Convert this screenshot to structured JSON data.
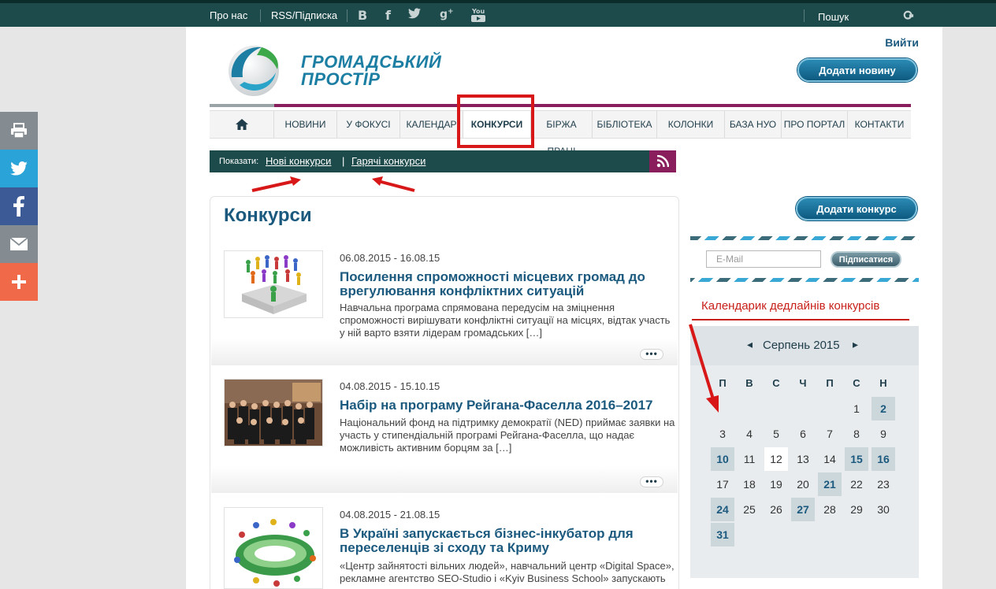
{
  "topbar": {
    "about": "Про нас",
    "rss": "RSS/Підписка",
    "social_icons": [
      "B",
      "f",
      "twitter",
      "g+",
      "youtube"
    ],
    "youtube_label": "You",
    "search_placeholder": "Пошук"
  },
  "share_bar": [
    {
      "icon": "print-icon",
      "color": "#848c91"
    },
    {
      "icon": "twitter-icon",
      "color": "#2aa3d8"
    },
    {
      "icon": "facebook-icon",
      "color": "#3b5a96"
    },
    {
      "icon": "mail-icon",
      "color": "#848c91"
    },
    {
      "icon": "plus-icon",
      "color": "#f06a4a"
    }
  ],
  "header": {
    "logo_line1": "ГРОМАДСЬКИЙ",
    "logo_line2": "ПРОСТІР",
    "login": "Вийти",
    "add_news": "Додати новину"
  },
  "nav": [
    {
      "label": ""
    },
    {
      "label": "НОВИНИ"
    },
    {
      "label": "У ФОКУСІ"
    },
    {
      "label": "КАЛЕНДАР"
    },
    {
      "label": "КОНКУРСИ",
      "active": true
    },
    {
      "label": "БІРЖА ПРАЦІ"
    },
    {
      "label": "БІБЛІОТЕКА"
    },
    {
      "label": "КОЛОНКИ"
    },
    {
      "label": "БАЗА НУО"
    },
    {
      "label": "ПРО ПОРТАЛ"
    },
    {
      "label": "КОНТАКТИ"
    }
  ],
  "filter": {
    "label": "Показати:",
    "link_new": "Нові конкурси",
    "separator": "|",
    "link_hot": "Гарячі конкурси"
  },
  "main": {
    "title": "Конкурси",
    "articles": [
      {
        "date": "06.08.2015 - 16.08.15",
        "title": "Посилення спроможності місцевих громад до врегулювання конфліктних ситуацій",
        "text": "Навчальна програма спрямована передусім на зміцнення спроможності вирішувати конфліктні ситуації на місцях, відтак участь у ній варто взяти лідерам громадських […]",
        "more": "•••"
      },
      {
        "date": "04.08.2015 - 15.10.15",
        "title": "Набір на програму Рейгана-Фаселла 2016–2017",
        "text": "Національний фонд на підтримку демократії (NED) приймає заявки на участь у стипендіальній програмі Рейгана-Фаселла, що надає можливість активним борцям за […]",
        "more": "•••"
      },
      {
        "date": "04.08.2015 - 21.08.15",
        "title": "В Україні запускається бізнес-інкубатор для переселенців зі сходу та Криму",
        "text": "«Центр зайнятості вільних людей», навчальний центр «Digital Space», рекламне агентство SEO-Studio і «Kyiv Business School» запускають"
      }
    ]
  },
  "sidebar": {
    "add_contest": "Додати конкурс",
    "email_placeholder": "E-Mail",
    "subscribe": "Підписатися",
    "annotation": "Календарик дедлайнів конкурсів",
    "calendar": {
      "month": "Серпень 2015",
      "weekdays": [
        "П",
        "В",
        "С",
        "Ч",
        "П",
        "С",
        "Н"
      ],
      "first_weekday": 5,
      "days": 31,
      "highlighted": [
        2,
        10,
        15,
        16,
        21,
        24,
        27,
        31
      ],
      "today": 12
    }
  }
}
